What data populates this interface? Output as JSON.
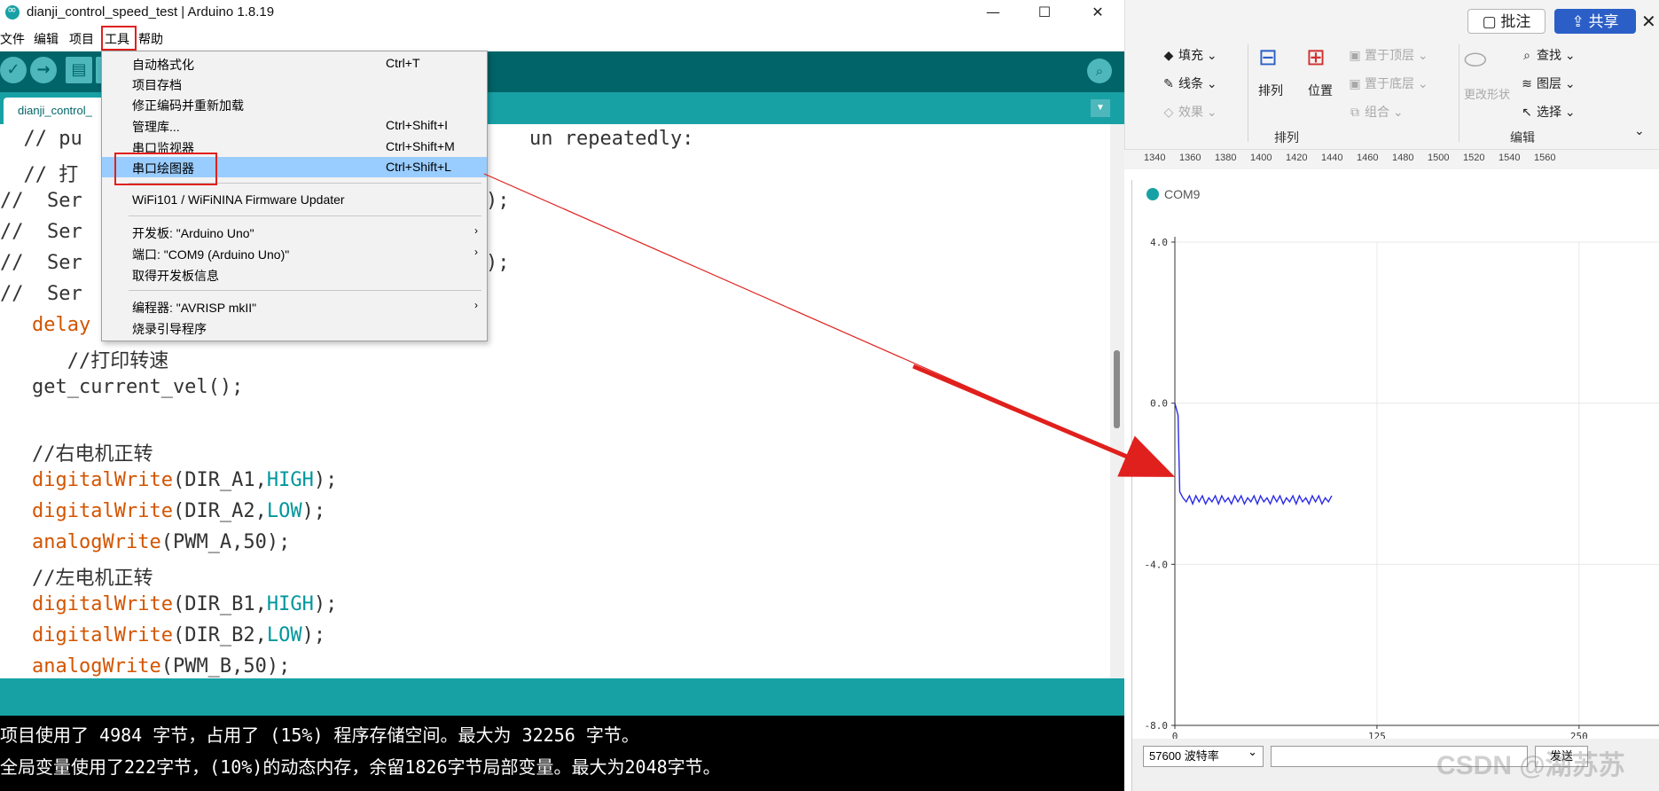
{
  "window": {
    "title": "dianji_control_speed_test | Arduino 1.8.19",
    "minimize": "—",
    "maximize": "☐",
    "close": "✕"
  },
  "menubar": [
    "文件",
    "编辑",
    "项目",
    "工具",
    "帮助"
  ],
  "toolbar": {
    "verify_glyph": "✓",
    "upload_glyph": "→",
    "new_glyph": "▤",
    "serial_glyph": "⌕"
  },
  "tab": {
    "label": "dianji_control_",
    "menu_glyph": "▼"
  },
  "tools_menu": {
    "items": [
      {
        "label": "自动格式化",
        "shortcut": "Ctrl+T"
      },
      {
        "label": "项目存档",
        "shortcut": ""
      },
      {
        "label": "修正编码并重新加载",
        "shortcut": ""
      },
      {
        "label": "管理库...",
        "shortcut": "Ctrl+Shift+I"
      },
      {
        "label": "串口监视器",
        "shortcut": "Ctrl+Shift+M"
      },
      {
        "label": "串口绘图器",
        "shortcut": "Ctrl+Shift+L"
      },
      {
        "label": "WiFi101 / WiFiNINA Firmware Updater",
        "shortcut": ""
      },
      {
        "label": "开发板: \"Arduino Uno\"",
        "shortcut": ""
      },
      {
        "label": "端口: \"COM9 (Arduino Uno)\"",
        "shortcut": ""
      },
      {
        "label": "取得开发板信息",
        "shortcut": ""
      },
      {
        "label": "编程器: \"AVRISP mkII\"",
        "shortcut": ""
      },
      {
        "label": "烧录引导程序",
        "shortcut": ""
      }
    ],
    "submenu_arrow": "›"
  },
  "code": {
    "line1a": "  // pu",
    "line1b": "un repeatedly:",
    "line2": "  // 打",
    "line3a": "//  Ser",
    "line3b": ");",
    "line4": "//  Ser",
    "line5a": "//  Ser",
    "line5b": ");",
    "line6": "//  Ser",
    "line7": "delay",
    "line8": "   //打印转速",
    "line9": "get_current_vel();",
    "line10": "//右电机正转",
    "fn_digitalWrite": "digitalWrite",
    "fn_analogWrite": "analogWrite",
    "line11_args": "(DIR_A1,",
    "line11_const": "HIGH",
    "line11_end": ");",
    "line12_args": "(DIR_A2,",
    "line12_const": "LOW",
    "line12_end": ");",
    "line13_args": "(PWM_A,50);",
    "line14": "//左电机正转",
    "line15_args": "(DIR_B1,",
    "line15_const": "HIGH",
    "line15_end": ");",
    "line16_args": "(DIR_B2,",
    "line16_const": "LOW",
    "line16_end": ");",
    "line17_args": "(PWM_B,50);"
  },
  "console": {
    "line1": "项目使用了 4984 字节，占用了 (15%) 程序存储空间。最大为 32256 字节。",
    "line2": "全局变量使用了222字节，(10%)的动态内存，余留1826字节局部变量。最大为2048字节。"
  },
  "ribbon": {
    "annotate": "批注",
    "share": "共享",
    "close": "✕",
    "fill": "填充",
    "line": "线条",
    "effect": "效果",
    "arrange": "排列",
    "position": "位置",
    "bring_front": "置于顶层",
    "send_back": "置于底层",
    "group": "组合",
    "change_shape": "更改形状",
    "find": "查找",
    "layers": "图层",
    "select": "选择",
    "group_arrange": "排列",
    "group_edit": "编辑"
  },
  "ruler": [
    "1340",
    "1360",
    "1380",
    "1400",
    "1420",
    "1440",
    "1460",
    "1480",
    "1500",
    "1520",
    "1540",
    "1560"
  ],
  "plotter": {
    "title": "COM9",
    "baud": "57600 波特率",
    "send": "发送"
  },
  "chart_data": {
    "type": "line",
    "title": "",
    "xlabel": "",
    "ylabel": "",
    "xlim": [
      0,
      300
    ],
    "ylim": [
      -8.0,
      4.0
    ],
    "x_ticks": [
      0,
      125,
      250
    ],
    "y_ticks": [
      4.0,
      0.0,
      -4.0,
      -8.0
    ],
    "y_tick_labels": [
      "4.0",
      "0.0",
      "-4.0",
      "-8.0"
    ],
    "grid": true,
    "series": [
      {
        "color": "#2a2ae8",
        "x": [
          0,
          2,
          3,
          5,
          7,
          9,
          11,
          13,
          15,
          17,
          19,
          21,
          23,
          25,
          27,
          29,
          31,
          33,
          35,
          37,
          39,
          41,
          43,
          45,
          47,
          49,
          51,
          53,
          55,
          57,
          59,
          61,
          63,
          65,
          67,
          69,
          71,
          73,
          75,
          77,
          79,
          81,
          83,
          85,
          87,
          89,
          91,
          93,
          95,
          97
        ],
        "y": [
          0.0,
          -0.3,
          -2.2,
          -2.35,
          -2.45,
          -2.3,
          -2.5,
          -2.3,
          -2.45,
          -2.3,
          -2.5,
          -2.35,
          -2.45,
          -2.3,
          -2.5,
          -2.3,
          -2.45,
          -2.35,
          -2.5,
          -2.3,
          -2.45,
          -2.3,
          -2.5,
          -2.35,
          -2.45,
          -2.3,
          -2.5,
          -2.3,
          -2.45,
          -2.35,
          -2.5,
          -2.3,
          -2.45,
          -2.3,
          -2.5,
          -2.35,
          -2.45,
          -2.3,
          -2.5,
          -2.3,
          -2.45,
          -2.35,
          -2.5,
          -2.3,
          -2.45,
          -2.3,
          -2.5,
          -2.35,
          -2.45,
          -2.3
        ]
      }
    ]
  },
  "watermark": "CSDN @湖苏苏",
  "colors": {
    "annotation_red": "#e0201d",
    "arduino_dark": "#006468",
    "arduino_teal": "#17a1a5",
    "menu_highlight": "#99ccff"
  }
}
